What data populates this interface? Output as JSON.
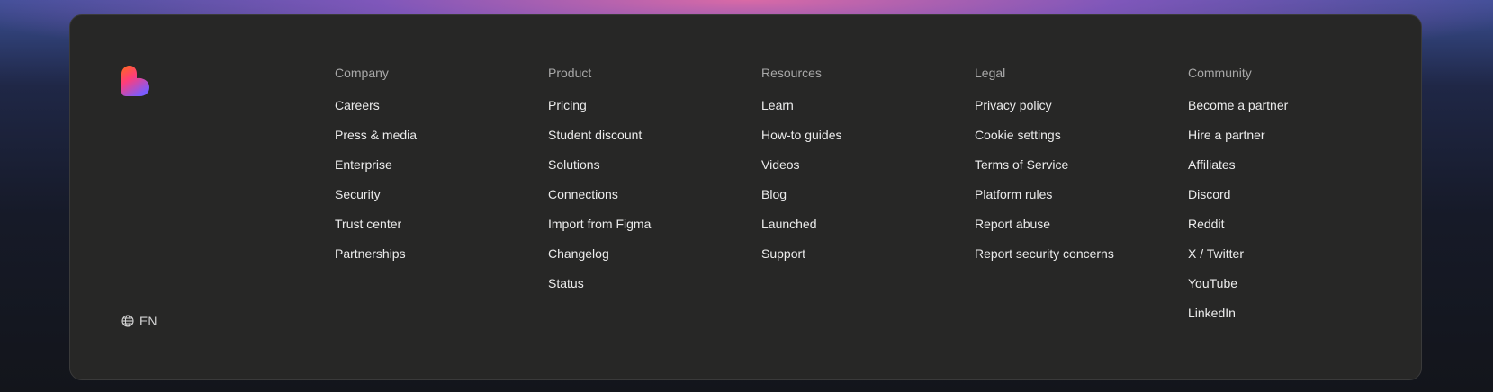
{
  "footer": {
    "logo_icon": "heart-logo-icon",
    "language": {
      "icon": "globe-icon",
      "label": "EN"
    },
    "columns": [
      {
        "heading": "Company",
        "items": [
          "Careers",
          "Press & media",
          "Enterprise",
          "Security",
          "Trust center",
          "Partnerships"
        ]
      },
      {
        "heading": "Product",
        "items": [
          "Pricing",
          "Student discount",
          "Solutions",
          "Connections",
          "Import from Figma",
          "Changelog",
          "Status"
        ]
      },
      {
        "heading": "Resources",
        "items": [
          "Learn",
          "How-to guides",
          "Videos",
          "Blog",
          "Launched",
          "Support"
        ]
      },
      {
        "heading": "Legal",
        "items": [
          "Privacy policy",
          "Cookie settings",
          "Terms of Service",
          "Platform rules",
          "Report abuse",
          "Report security concerns"
        ]
      },
      {
        "heading": "Community",
        "items": [
          "Become a partner",
          "Hire a partner",
          "Affiliates",
          "Discord",
          "Reddit",
          "X / Twitter",
          "YouTube",
          "LinkedIn"
        ]
      }
    ]
  }
}
